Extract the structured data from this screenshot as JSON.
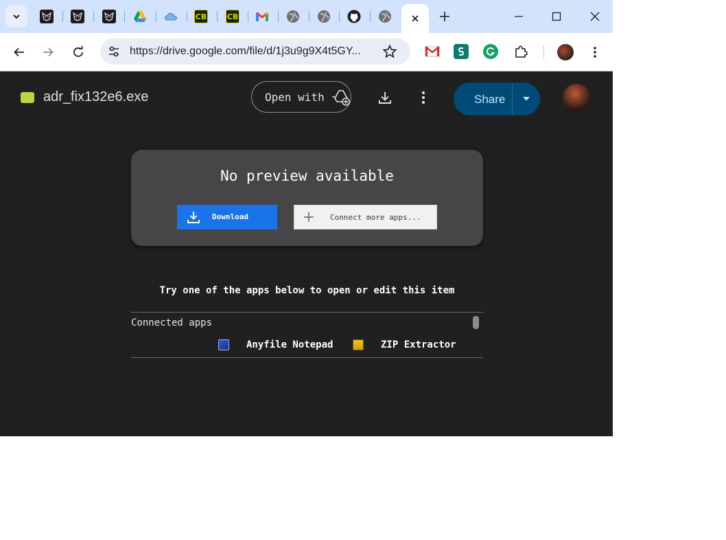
{
  "browser": {
    "tabs": [
      {
        "favicon": "ninja-icon"
      },
      {
        "favicon": "ninja-icon"
      },
      {
        "favicon": "ninja-icon"
      },
      {
        "favicon": "google-drive-icon"
      },
      {
        "favicon": "cloud-icon"
      },
      {
        "favicon": "cb-icon",
        "text": "CB"
      },
      {
        "favicon": "cb-icon",
        "text": "CB"
      },
      {
        "favicon": "gmail-icon"
      },
      {
        "favicon": "globe-icon"
      },
      {
        "favicon": "globe-icon"
      },
      {
        "favicon": "github-icon"
      },
      {
        "favicon": "globe-icon"
      }
    ],
    "url": "https://drive.google.com/file/d/1j3u9g9X4t5GY..."
  },
  "viewer": {
    "file_name": "adr_fix132e6.exe",
    "open_with_label": "Open with",
    "share_label": "Share"
  },
  "preview": {
    "title": "No preview available",
    "download_label": "Download",
    "connect_label": "Connect more apps..."
  },
  "apps": {
    "prompt": "Try one of the apps below to open or edit this item",
    "heading": "Connected apps",
    "items": [
      {
        "name": "Anyfile Notepad",
        "icon": "notepad-icon"
      },
      {
        "name": "ZIP Extractor",
        "icon": "zip-icon"
      }
    ]
  },
  "colors": {
    "tabstrip": "#d3e3fd",
    "viewer_bg": "#202020",
    "card_bg": "#464547",
    "download_button": "#1a73e8",
    "share_button": "#004a77"
  }
}
